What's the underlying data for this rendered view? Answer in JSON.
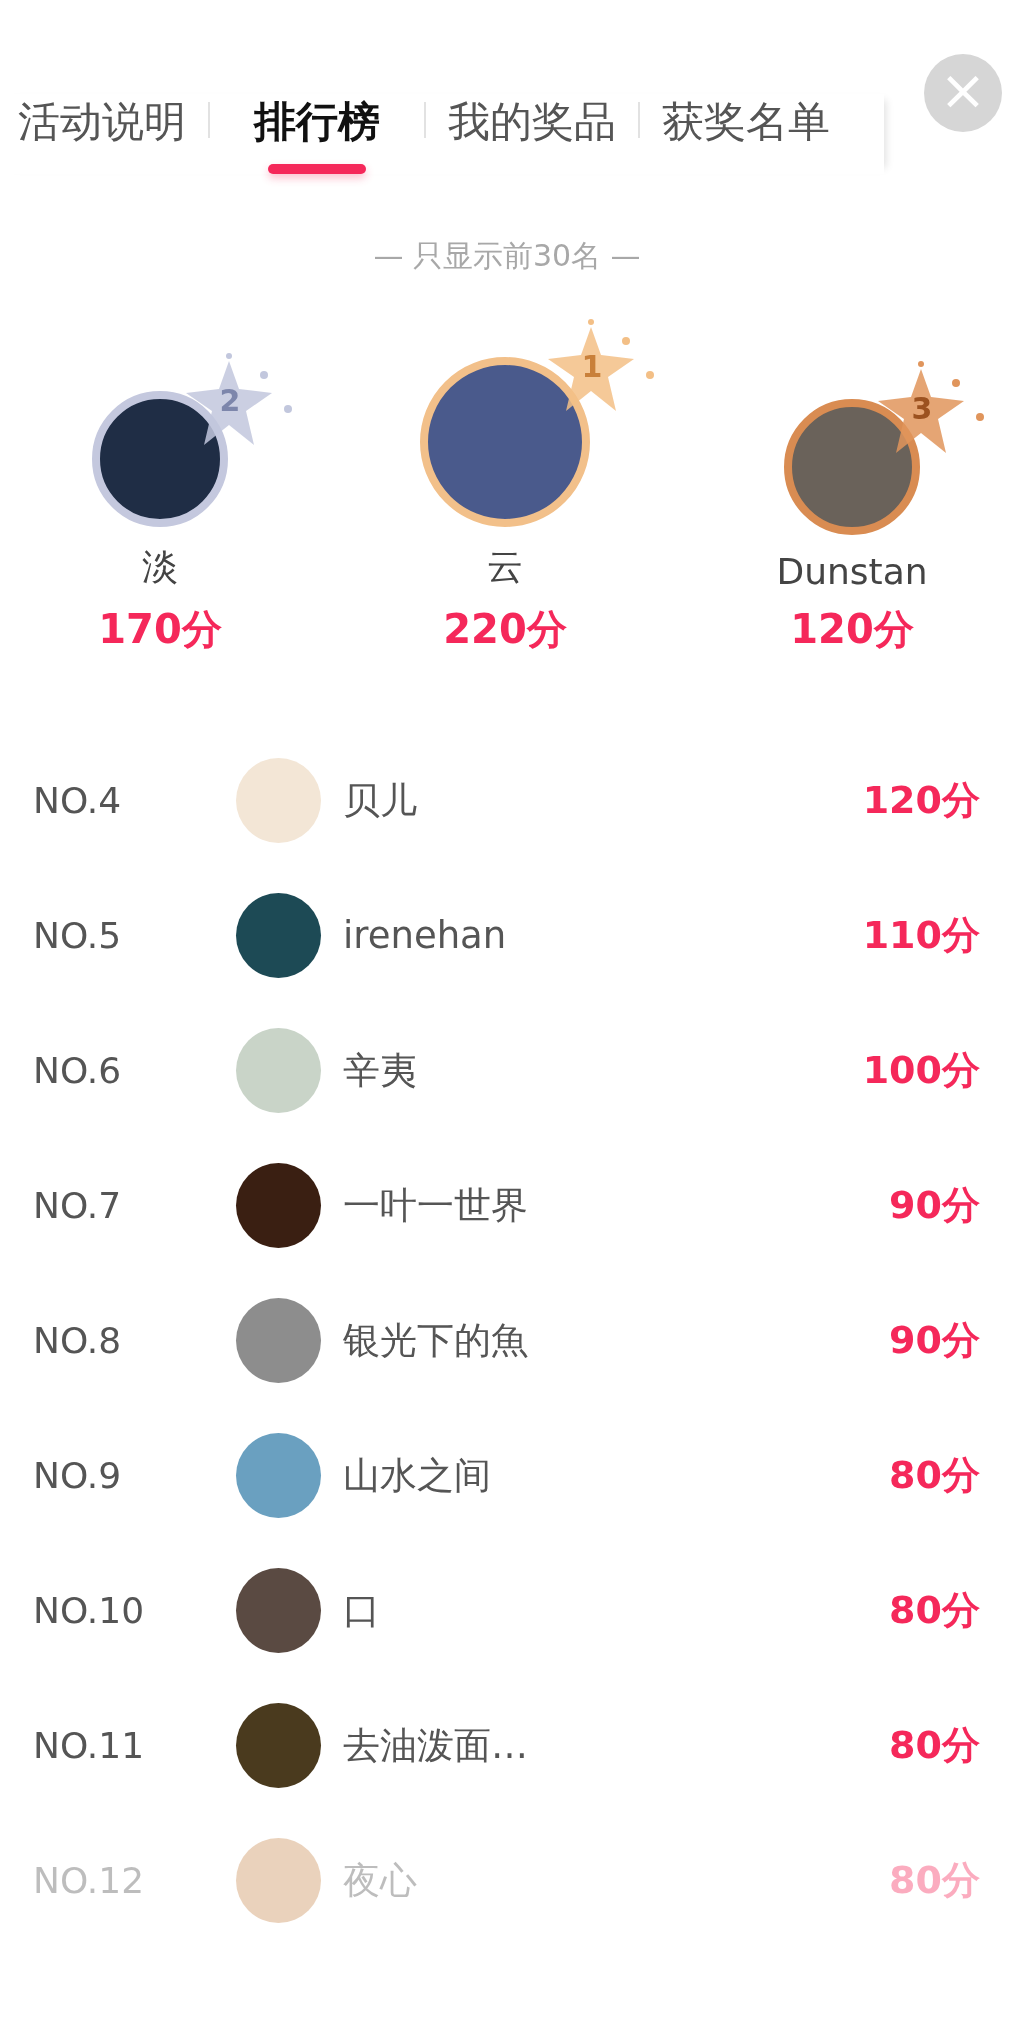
{
  "tabs": [
    {
      "label": "活动说明",
      "selected": false
    },
    {
      "label": "排行榜",
      "selected": true
    },
    {
      "label": "我的奖品",
      "selected": false
    },
    {
      "label": "获奖名单",
      "selected": false
    }
  ],
  "close_button": {
    "label": "×"
  },
  "notice": "— 只显示前30名 —",
  "podium": [
    {
      "rank": "2",
      "name": "淡",
      "score": "170分",
      "kind": "silver"
    },
    {
      "rank": "1",
      "name": "云",
      "score": "220分",
      "kind": "gold"
    },
    {
      "rank": "3",
      "name": "Dunstan",
      "score": "120分",
      "kind": "bronze"
    }
  ],
  "rows": [
    {
      "no": "NO.4",
      "name": "贝儿",
      "score": "120分",
      "faded": false
    },
    {
      "no": "NO.5",
      "name": "irenehan",
      "score": "110分",
      "faded": false
    },
    {
      "no": "NO.6",
      "name": "辛夷",
      "score": "100分",
      "faded": false
    },
    {
      "no": "NO.7",
      "name": "一叶一世界",
      "score": "90分",
      "faded": false
    },
    {
      "no": "NO.8",
      "name": "银光下的魚",
      "score": "90分",
      "faded": false
    },
    {
      "no": "NO.9",
      "name": "山水之间",
      "score": "80分",
      "faded": false
    },
    {
      "no": "NO.10",
      "name": "口",
      "score": "80分",
      "faded": false
    },
    {
      "no": "NO.11",
      "name": "去油泼面…",
      "score": "80分",
      "faded": false
    },
    {
      "no": "NO.12",
      "name": "夜心",
      "score": "80分",
      "faded": true
    }
  ]
}
